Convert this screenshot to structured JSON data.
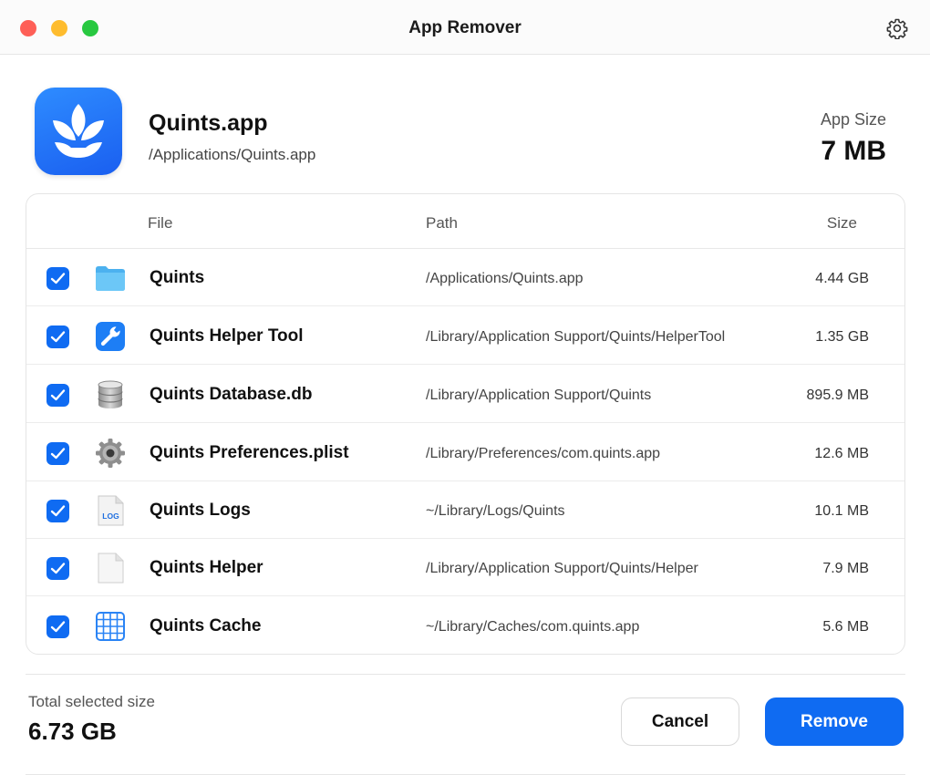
{
  "window": {
    "title": "App Remover",
    "settings_icon": "gear-icon"
  },
  "app": {
    "name": "Quints.app",
    "path": "/Applications/Quints.app",
    "icon": "leaf-icon",
    "size_label": "App Size",
    "size_value": "7 MB"
  },
  "table": {
    "headers": {
      "file": "File",
      "path": "Path",
      "size": "Size"
    },
    "rows": [
      {
        "checked": true,
        "icon": "folder-icon",
        "name": "Quints",
        "path": "/Applications/Quints.app",
        "size": "4.44 GB"
      },
      {
        "checked": true,
        "icon": "wrench-icon",
        "name": "Quints Helper Tool",
        "path": "/Library/Application Support/Quints/HelperTool",
        "size": "1.35 GB"
      },
      {
        "checked": true,
        "icon": "database-icon",
        "name": "Quints Database.db",
        "path": "/Library/Application Support/Quints",
        "size": "895.9 MB"
      },
      {
        "checked": true,
        "icon": "gear-icon",
        "name": "Quints Preferences.plist",
        "path": "/Library/Preferences/com.quints.app",
        "size": "12.6 MB"
      },
      {
        "checked": true,
        "icon": "log-file-icon",
        "log_badge": "LOG",
        "name": "Quints Logs",
        "path": "~/Library/Logs/Quints",
        "size": "10.1 MB"
      },
      {
        "checked": true,
        "icon": "document-icon",
        "name": "Quints Helper",
        "path": "/Library/Application Support/Quints/Helper",
        "size": "7.9 MB"
      },
      {
        "checked": true,
        "icon": "grid-icon",
        "name": "Quints Cache",
        "path": "~/Library/Caches/com.quints.app",
        "size": "5.6 MB"
      }
    ]
  },
  "footer": {
    "total_label": "Total selected size",
    "total_value": "6.73 GB",
    "cancel_label": "Cancel",
    "remove_label": "Remove"
  },
  "colors": {
    "accent": "#0f6bf2",
    "close": "#fe5f57",
    "minimize": "#febc2e",
    "zoom": "#28c840"
  }
}
